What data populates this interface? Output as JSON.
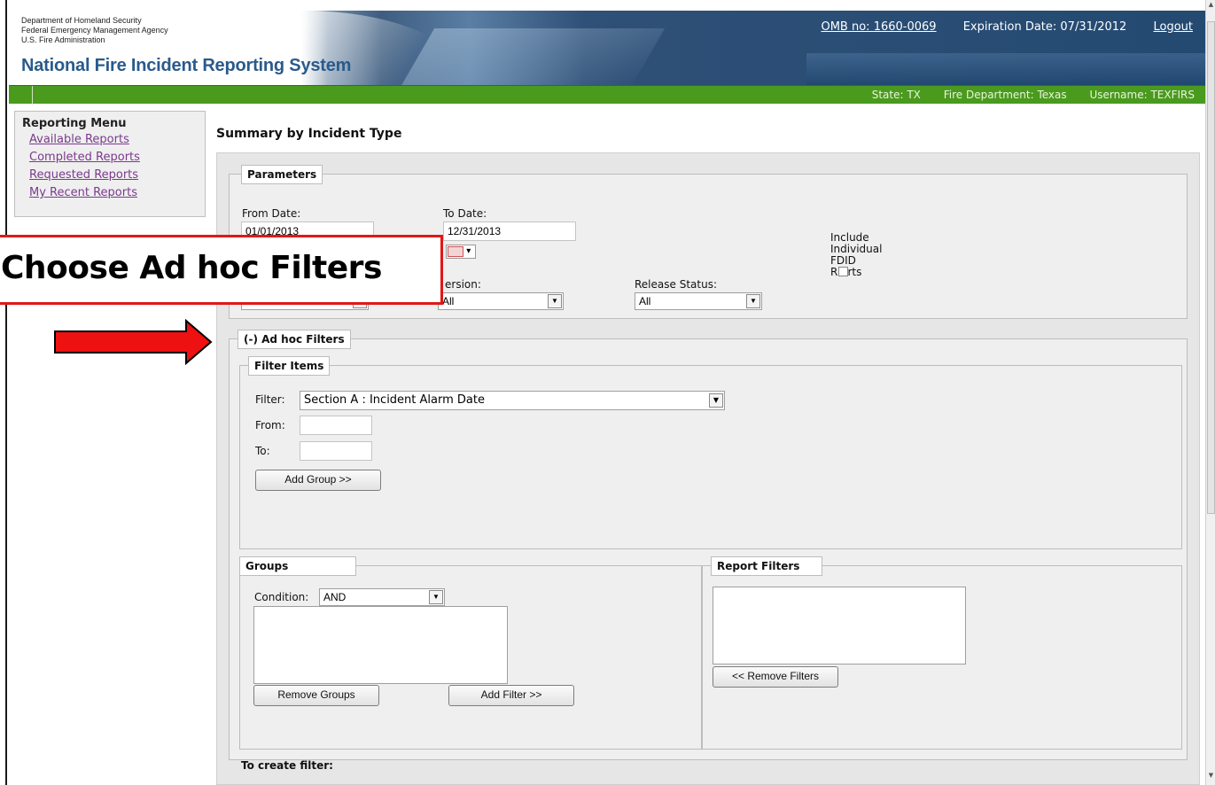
{
  "header": {
    "agency_lines": [
      "Department of Homeland Security",
      "Federal Emergency Management Agency",
      "U.S. Fire Administration"
    ],
    "site_title": "National Fire Incident Reporting System",
    "omb": "OMB no: 1660-0069",
    "expiration": "Expiration Date: 07/31/2012",
    "logout": "Logout"
  },
  "statusbar": {
    "state": "State: TX",
    "fire_department": "Fire Department: Texas",
    "username": "Username: TEXFIRS"
  },
  "sidebar": {
    "title": "Reporting Menu",
    "items": [
      "Available Reports",
      "Completed Reports",
      "Requested Reports",
      "My Recent Reports"
    ]
  },
  "page": {
    "heading": "Summary by Incident Type"
  },
  "parameters": {
    "legend": "Parameters",
    "from_date_label": "From Date:",
    "from_date_value": "01/01/2013",
    "to_date_label": "To Date:",
    "to_date_value": "12/31/2013",
    "version_label": "ersion:",
    "version_value": "All",
    "release_label": "Release Status:",
    "release_value": "All",
    "include_lines": [
      "Include",
      "Individual",
      "FDID",
      "R  orts"
    ]
  },
  "adhoc": {
    "legend": "(-) Ad hoc Filters",
    "filter_items_legend": "Filter Items",
    "filter_label": "Filter:",
    "filter_value": "Section A : Incident Alarm Date",
    "from_label": "From:",
    "to_label": "To:",
    "add_group": "Add Group >>"
  },
  "groups": {
    "legend": "Groups",
    "condition_label": "Condition:",
    "condition_value": "AND",
    "remove_groups": "Remove Groups",
    "add_filter": "Add Filter >>"
  },
  "report_filters": {
    "legend": "Report Filters",
    "remove_filters": "<< Remove Filters"
  },
  "instructions": {
    "heading": "To create filter:"
  },
  "callout": {
    "text": "Choose Ad hoc Filters"
  }
}
